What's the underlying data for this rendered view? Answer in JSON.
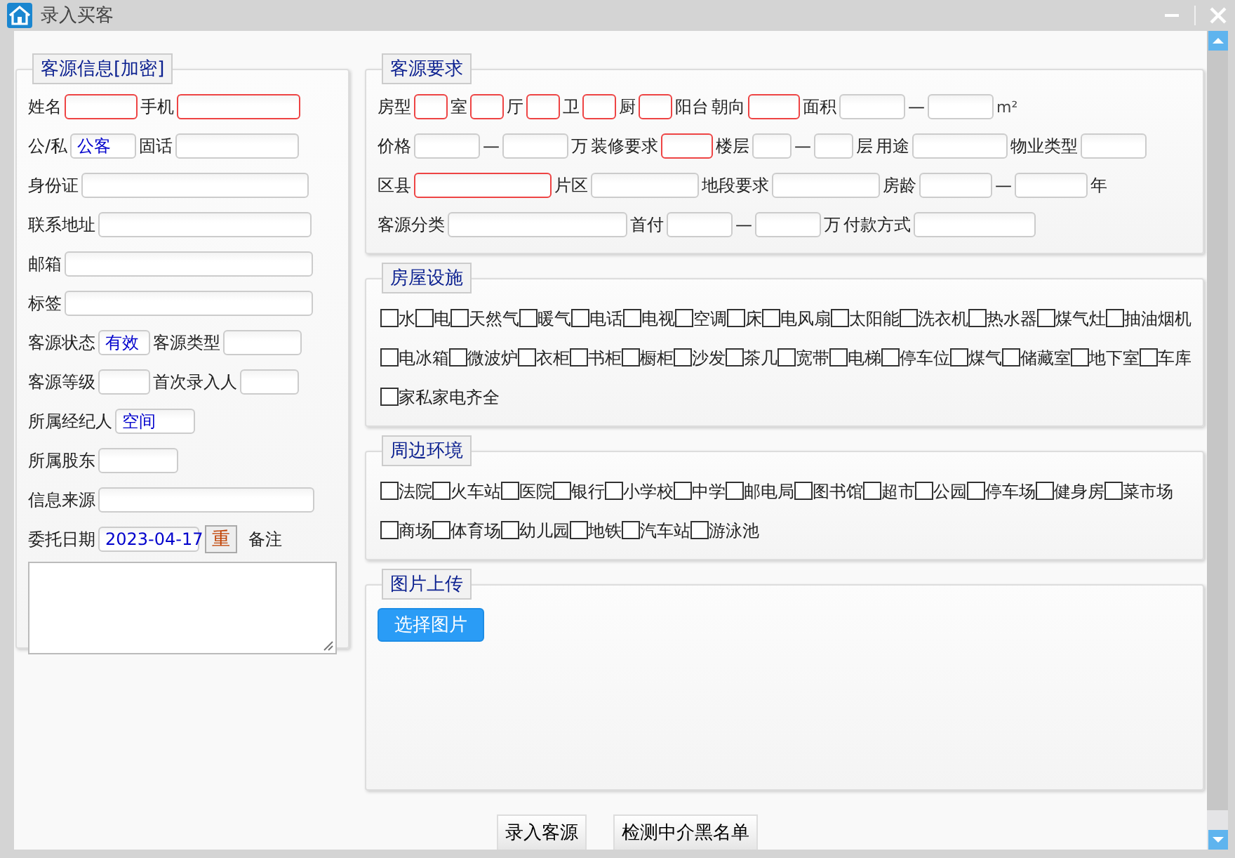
{
  "window": {
    "title": "录入买客"
  },
  "customer_info": {
    "legend": "客源信息[加密]",
    "rows": [
      {
        "items": [
          {
            "kind": "label",
            "text": "姓名"
          },
          {
            "kind": "field",
            "required": true
          },
          {
            "kind": "label",
            "text": "手机"
          },
          {
            "kind": "field",
            "required": true
          }
        ]
      },
      {
        "items": [
          {
            "kind": "label",
            "text": "公/私"
          },
          {
            "kind": "field",
            "required": false,
            "value": "公客"
          },
          {
            "kind": "label",
            "text": "固话"
          },
          {
            "kind": "field",
            "required": false
          }
        ]
      },
      {
        "items": [
          {
            "kind": "label",
            "text": "身份证"
          },
          {
            "kind": "field",
            "required": false
          }
        ]
      },
      {
        "items": [
          {
            "kind": "label",
            "text": "联系地址"
          },
          {
            "kind": "field",
            "required": false
          }
        ]
      },
      {
        "items": [
          {
            "kind": "label",
            "text": "邮箱"
          },
          {
            "kind": "field",
            "required": false
          }
        ]
      },
      {
        "items": [
          {
            "kind": "label",
            "text": "标签"
          },
          {
            "kind": "field",
            "required": false
          }
        ]
      },
      {
        "items": [
          {
            "kind": "label",
            "text": "客源状态"
          },
          {
            "kind": "field",
            "required": false,
            "value": "有效"
          },
          {
            "kind": "label",
            "text": "客源类型"
          },
          {
            "kind": "field",
            "required": false
          }
        ]
      },
      {
        "items": [
          {
            "kind": "label",
            "text": "客源等级"
          },
          {
            "kind": "field",
            "required": false
          },
          {
            "kind": "label",
            "text": "首次录入人"
          },
          {
            "kind": "field",
            "required": false
          }
        ]
      },
      {
        "items": [
          {
            "kind": "label",
            "text": "所属经纪人"
          },
          {
            "kind": "field",
            "required": false,
            "value": "空间"
          }
        ]
      },
      {
        "items": [
          {
            "kind": "label",
            "text": "所属股东"
          },
          {
            "kind": "field",
            "required": false
          }
        ]
      },
      {
        "items": [
          {
            "kind": "label",
            "text": "信息来源"
          },
          {
            "kind": "field",
            "required": false
          }
        ]
      },
      {
        "items": [
          {
            "kind": "label",
            "text": "委托日期"
          },
          {
            "kind": "field",
            "required": false,
            "value": "2023-04-17"
          },
          {
            "kind": "button",
            "text": "重"
          },
          {
            "kind": "label",
            "text": "备注"
          }
        ]
      }
    ]
  },
  "requirements": {
    "legend": "客源要求",
    "rows": [
      {
        "items": [
          {
            "kind": "label",
            "text": "房型"
          },
          {
            "kind": "field",
            "required": true
          },
          {
            "kind": "label",
            "text": "室"
          },
          {
            "kind": "field",
            "required": true
          },
          {
            "kind": "label",
            "text": "厅"
          },
          {
            "kind": "field",
            "required": true
          },
          {
            "kind": "label",
            "text": "卫"
          },
          {
            "kind": "field",
            "required": true
          },
          {
            "kind": "label",
            "text": "厨"
          },
          {
            "kind": "field",
            "required": true
          },
          {
            "kind": "label",
            "text": "阳台"
          },
          {
            "kind": "label",
            "text": "朝向"
          },
          {
            "kind": "field",
            "required": true
          },
          {
            "kind": "label",
            "text": "面积"
          },
          {
            "kind": "field",
            "required": false
          },
          {
            "kind": "label",
            "text": "—"
          },
          {
            "kind": "field",
            "required": false
          },
          {
            "kind": "unit",
            "text": "m²"
          }
        ]
      },
      {
        "items": [
          {
            "kind": "label",
            "text": "价格"
          },
          {
            "kind": "field",
            "required": false
          },
          {
            "kind": "label",
            "text": "—"
          },
          {
            "kind": "field",
            "required": false
          },
          {
            "kind": "label",
            "text": "万"
          },
          {
            "kind": "label",
            "text": "装修要求"
          },
          {
            "kind": "field",
            "required": true
          },
          {
            "kind": "label",
            "text": "楼层"
          },
          {
            "kind": "field",
            "required": false
          },
          {
            "kind": "label",
            "text": "—"
          },
          {
            "kind": "field",
            "required": false
          },
          {
            "kind": "label",
            "text": "层"
          },
          {
            "kind": "label",
            "text": "用途"
          },
          {
            "kind": "field",
            "required": false
          },
          {
            "kind": "label",
            "text": "物业类型"
          },
          {
            "kind": "field",
            "required": false
          }
        ]
      },
      {
        "items": [
          {
            "kind": "label",
            "text": "区县"
          },
          {
            "kind": "field",
            "required": true
          },
          {
            "kind": "label",
            "text": "片区"
          },
          {
            "kind": "field",
            "required": false
          },
          {
            "kind": "label",
            "text": "地段要求"
          },
          {
            "kind": "field",
            "required": false
          },
          {
            "kind": "label",
            "text": "房龄"
          },
          {
            "kind": "field",
            "required": false
          },
          {
            "kind": "label",
            "text": "—"
          },
          {
            "kind": "field",
            "required": false
          },
          {
            "kind": "label",
            "text": "年"
          }
        ]
      },
      {
        "items": [
          {
            "kind": "label",
            "text": "客源分类"
          },
          {
            "kind": "field",
            "required": false
          },
          {
            "kind": "label",
            "text": "首付"
          },
          {
            "kind": "field",
            "required": false
          },
          {
            "kind": "label",
            "text": "—"
          },
          {
            "kind": "field",
            "required": false
          },
          {
            "kind": "label",
            "text": "万"
          },
          {
            "kind": "label",
            "text": "付款方式"
          },
          {
            "kind": "field",
            "required": false
          }
        ]
      }
    ]
  },
  "facilities": {
    "legend": "房屋设施",
    "items": [
      {
        "label": "水",
        "checked": false
      },
      {
        "label": "电",
        "checked": false
      },
      {
        "label": "天然气",
        "checked": false
      },
      {
        "label": "暖气",
        "checked": false
      },
      {
        "label": "电话",
        "checked": false
      },
      {
        "label": "电视",
        "checked": false
      },
      {
        "label": "空调",
        "checked": false
      },
      {
        "label": "床",
        "checked": false
      },
      {
        "label": "电风扇",
        "checked": false
      },
      {
        "label": "太阳能",
        "checked": false
      },
      {
        "label": "洗衣机",
        "checked": false
      },
      {
        "label": "热水器",
        "checked": false
      },
      {
        "label": "煤气灶",
        "checked": false
      },
      {
        "label": "抽油烟机",
        "checked": false
      },
      {
        "label": "电冰箱",
        "checked": false
      },
      {
        "label": "微波炉",
        "checked": false
      },
      {
        "label": "衣柜",
        "checked": false
      },
      {
        "label": "书柜",
        "checked": false
      },
      {
        "label": "橱柜",
        "checked": false
      },
      {
        "label": "沙发",
        "checked": false
      },
      {
        "label": "茶几",
        "checked": false
      },
      {
        "label": "宽带",
        "checked": false
      },
      {
        "label": "电梯",
        "checked": false
      },
      {
        "label": "停车位",
        "checked": false
      },
      {
        "label": "煤气",
        "checked": false
      },
      {
        "label": "储藏室",
        "checked": false
      },
      {
        "label": "地下室",
        "checked": false
      },
      {
        "label": "车库",
        "checked": false
      },
      {
        "label": "家私家电齐全",
        "checked": false
      }
    ]
  },
  "surroundings": {
    "legend": "周边环境",
    "items": [
      {
        "label": "法院",
        "checked": false
      },
      {
        "label": "火车站",
        "checked": false
      },
      {
        "label": "医院",
        "checked": false
      },
      {
        "label": "银行",
        "checked": false
      },
      {
        "label": "小学校",
        "checked": false
      },
      {
        "label": "中学",
        "checked": false
      },
      {
        "label": "邮电局",
        "checked": false
      },
      {
        "label": "图书馆",
        "checked": false
      },
      {
        "label": "超市",
        "checked": false
      },
      {
        "label": "公园",
        "checked": false
      },
      {
        "label": "停车场",
        "checked": false
      },
      {
        "label": "健身房",
        "checked": false
      },
      {
        "label": "菜市场",
        "checked": false
      },
      {
        "label": "商场",
        "checked": false
      },
      {
        "label": "体育场",
        "checked": false
      },
      {
        "label": "幼儿园",
        "checked": false
      },
      {
        "label": "地铁",
        "checked": false
      },
      {
        "label": "汽车站",
        "checked": false
      },
      {
        "label": "游泳池",
        "checked": false
      }
    ]
  },
  "upload": {
    "legend": "图片上传",
    "button": "选择图片"
  },
  "buttons": [
    "录入客源",
    "检测中介黑名单"
  ]
}
